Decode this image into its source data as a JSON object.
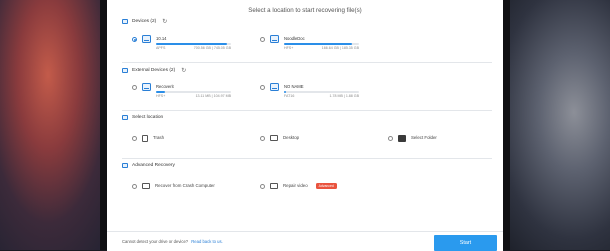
{
  "title": "Select a location to start recovering file(s)",
  "sections": {
    "devices": {
      "label": "Devices (2)"
    },
    "external": {
      "label": "External Devices (2)"
    },
    "location": {
      "label": "Select location"
    },
    "advanced": {
      "label": "Advanced Recovery"
    }
  },
  "devices": [
    {
      "name": "10.14",
      "fs": "APFS",
      "size": "700.56 GB | 745.05 GB",
      "fill": 0.94,
      "selected": true
    },
    {
      "name": "NoodleDoc",
      "fs": "HFS+",
      "size": "166.64 GB | 185.35 GB",
      "fill": 0.9,
      "selected": false
    }
  ],
  "external": [
    {
      "name": "Recoverit",
      "fs": "HFS+",
      "size": "13.11 MB | 104.97 MB",
      "fill": 0.12
    },
    {
      "name": "NO NAME",
      "fs": "FAT16",
      "size": "1.78 MB | 1.88 GB",
      "fill": 0.01
    }
  ],
  "locations": [
    "Trash",
    "Desktop",
    "Select Folder"
  ],
  "advanced": {
    "crash": "Recover from Crash Computer",
    "repair": "Repair video",
    "badge": "Advanced"
  },
  "bottom": {
    "help_text": "Cannot detect your drive or device?",
    "help_link": "Read back to us.",
    "start": "Start"
  },
  "colors": {
    "accent": "#2a8ee8",
    "badge": "#e9533e"
  }
}
